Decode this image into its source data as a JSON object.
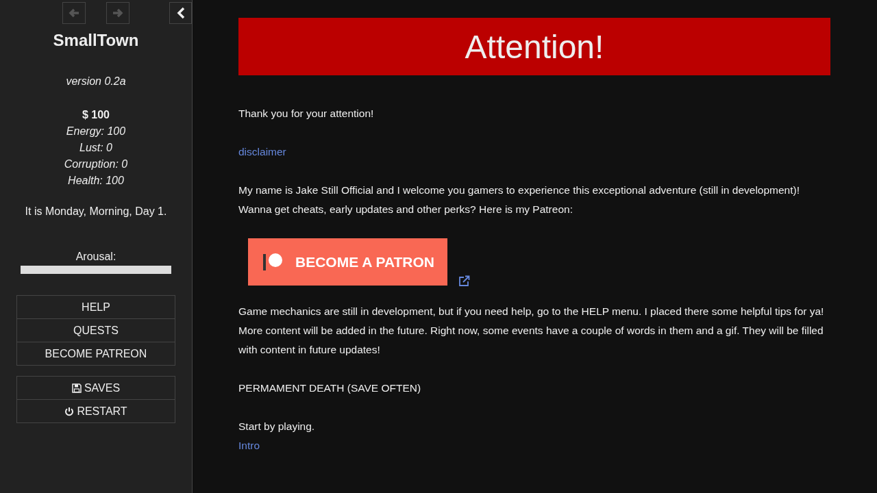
{
  "sidebar": {
    "history": [
      {
        "kind": "back",
        "disabled": true
      },
      {
        "kind": "forward",
        "disabled": true
      }
    ],
    "title": "SmallTown",
    "version": "version 0.2a",
    "stats": [
      {
        "text": "$ 100",
        "kind": "money"
      },
      {
        "text": "Energy: 100",
        "kind": "stat"
      },
      {
        "text": "Lust: 0",
        "kind": "stat"
      },
      {
        "text": "Corruption: 0",
        "kind": "stat"
      },
      {
        "text": "Health: 100",
        "kind": "stat"
      }
    ],
    "time": "It is Monday, Morning, Day 1.",
    "meter": {
      "label": "Arousal:",
      "level": 0
    },
    "menu": [
      {
        "label": "HELP"
      },
      {
        "label": "QUESTS"
      },
      {
        "label": "BECOME PATREON"
      }
    ],
    "actions": [
      {
        "label": "SAVES",
        "kind": "save"
      },
      {
        "label": "RESTART",
        "kind": "power"
      }
    ]
  },
  "main": {
    "banner": "Attention!",
    "blocks": [
      {
        "kind": "text",
        "lines": [
          "Thank you for your attention!"
        ]
      },
      {
        "kind": "link",
        "text": "disclaimer"
      },
      {
        "kind": "text",
        "lines": [
          "My name is Jake Still Official and I welcome you gamers to experience this exceptional adventure (still in development)!",
          "Wanna get cheats, early updates and other perks? Here is my Patreon:"
        ]
      },
      {
        "kind": "patreon",
        "text": "BECOME A PATRON"
      },
      {
        "kind": "text",
        "lines": [
          "Game mechanics are still in development, but if you need help, go to the HELP menu. I placed there some helpful tips for ya!",
          "More content will be added in the future. Right now, some events have a couple of words in them and a gif. They will be filled",
          "with content in future updates!"
        ]
      },
      {
        "kind": "text",
        "lines": [
          "PERMAMENT DEATH (SAVE OFTEN)"
        ]
      },
      {
        "kind": "text",
        "lines": [
          "Start by playing."
        ],
        "link": "Intro"
      }
    ]
  }
}
